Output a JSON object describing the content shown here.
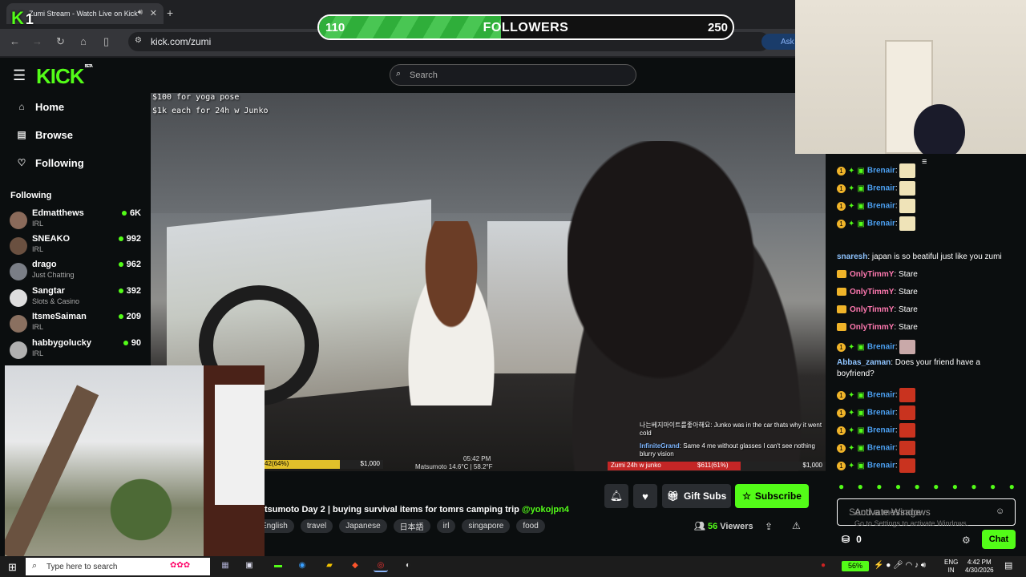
{
  "browser": {
    "tab_title": "Zumi Stream - Watch Live on Kick",
    "url": "kick.com/zumi",
    "ask_label": "Ask"
  },
  "overlay": {
    "kick_badge": "K",
    "kick_badge_num": "1",
    "followers_min": "110",
    "followers_label": "FOLLOWERS",
    "followers_max": "250",
    "followers_progress": 0.44
  },
  "site": {
    "logo": "KICK",
    "logo_beta": "BETA",
    "search_placeholder": "Search"
  },
  "sidebar": {
    "nav": [
      {
        "label": "Home",
        "icon": "home-icon"
      },
      {
        "label": "Browse",
        "icon": "browse-icon"
      },
      {
        "label": "Following",
        "icon": "heart-icon"
      }
    ],
    "following_heading": "Following",
    "following": [
      {
        "name": "Edmatthews",
        "category": "IRL",
        "viewers": "6K"
      },
      {
        "name": "SNEAKO",
        "category": "IRL",
        "viewers": "992"
      },
      {
        "name": "drago",
        "category": "Just Chatting",
        "viewers": "962"
      },
      {
        "name": "Sangtar",
        "category": "Slots & Casino",
        "viewers": "392"
      },
      {
        "name": "ItsmeSaiman",
        "category": "IRL",
        "viewers": "209"
      },
      {
        "name": "habbygolucky",
        "category": "IRL",
        "viewers": "90"
      }
    ]
  },
  "video": {
    "overlay_line1": "$100 for yoga pose",
    "overlay_line2": "$1k each for 24h w Junko",
    "goal_left_pct": "42(64%)",
    "goal_left_amt": "$1,000",
    "goal_left_progress": 0.64,
    "time": "05:42 PM",
    "weather": "Matsumoto 14.6°C | 58.2°F",
    "goal_right_label": "Zumi 24h w junko",
    "goal_right_mid": "$611(61%)",
    "goal_right_amt": "$1,000",
    "goal_right_progress": 0.61,
    "chat_overlay": [
      {
        "user": "",
        "text": "나는베지마이트를좋아해요: Junko was in the car thats why it went cold"
      },
      {
        "user": "InfiniteGrand",
        "text": ": Same 4 me without glasses I can't see nothing blurry vision"
      }
    ]
  },
  "stream": {
    "title": "tsumoto Day 2 | buying survival items for tomrs camping trip ",
    "title_tag": "@yokojpn4",
    "tags": [
      "English",
      "travel",
      "Japanese",
      "日本語",
      "irl",
      "singapore",
      "food"
    ],
    "gift_label": "Gift Subs",
    "subscribe_label": "Subscribe",
    "viewers_count": "56",
    "viewers_label": "Viewers"
  },
  "chat": {
    "messages": [
      {
        "type": "gift",
        "user": "Brenair",
        "text": ":",
        "emote_color": "#efe3b8"
      },
      {
        "type": "gift",
        "user": "Brenair",
        "text": ":",
        "emote_color": "#efe3b8"
      },
      {
        "type": "gift",
        "user": "Brenair",
        "text": ":",
        "emote_color": "#efe3b8"
      },
      {
        "type": "gift",
        "user": "Brenair",
        "text": ":",
        "emote_color": "#efe3b8"
      },
      {
        "type": "plain",
        "user": "snaresh",
        "text": ": japan is so beatiful just like you zumi"
      },
      {
        "type": "crown",
        "user": "OnlyTimmY",
        "text": ": Stare"
      },
      {
        "type": "crown",
        "user": "OnlyTimmY",
        "text": ": Stare"
      },
      {
        "type": "crown",
        "user": "OnlyTimmY",
        "text": ": Stare"
      },
      {
        "type": "crown",
        "user": "OnlyTimmY",
        "text": ": Stare"
      },
      {
        "type": "gift",
        "user": "Brenair",
        "text": ":",
        "emote_color": "#c9a9a9"
      },
      {
        "type": "plain2",
        "user": "Abbas_zaman",
        "text": ": Does your friend have a",
        "text2": "boyfriend?"
      },
      {
        "type": "gift",
        "user": "Brenair",
        "text": ":",
        "emote_color": "#c9331f"
      },
      {
        "type": "gift",
        "user": "Brenair",
        "text": ":",
        "emote_color": "#c9331f"
      },
      {
        "type": "gift",
        "user": "Brenair",
        "text": ":",
        "emote_color": "#c9331f"
      },
      {
        "type": "gift",
        "user": "Brenair",
        "text": ":",
        "emote_color": "#c9331f"
      },
      {
        "type": "gift",
        "user": "Brenair",
        "text": ":",
        "emote_color": "#c9331f"
      }
    ],
    "input_placeholder": "Send a message",
    "watermark_line1": "Activate Windows",
    "watermark_line2": "Go to Settings to activate Windows.",
    "points": "0",
    "chat_button": "Chat"
  },
  "taskbar": {
    "search_placeholder": "Type here to search",
    "battery": "56%",
    "lang1": "ENG",
    "lang2": "IN",
    "time": "4:42 PM",
    "date": "4/30/2026"
  },
  "colors": {
    "kick_green": "#53fc18",
    "chat_user_blue": "#4b9ff0",
    "chat_user_pink": "#ff79b0",
    "chat_user_lightblue": "#8fc4ff"
  }
}
